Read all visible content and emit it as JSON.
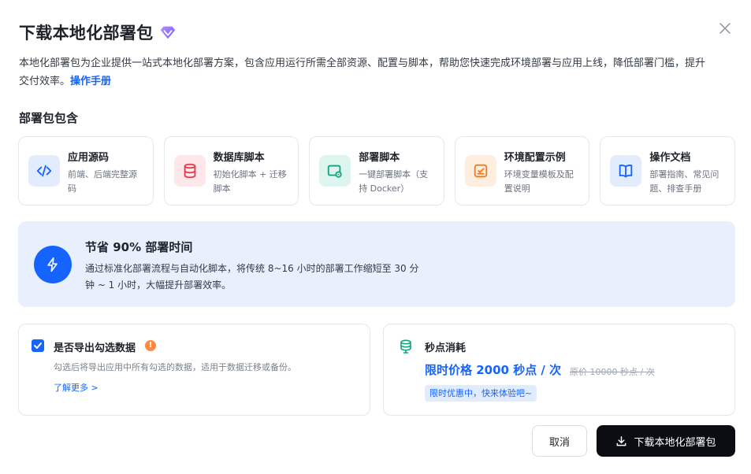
{
  "dialog": {
    "title": "下载本地化部署包",
    "description_pre": "本地化部署包为企业提供一站式本地化部署方案，包含应用运行所需全部资源、配置与脚本，帮助您快速完成环境部署与应用上线，降低部署门槛，提升交付效率。",
    "manual_link": "操作手册"
  },
  "section_title": "部署包包含",
  "cards": [
    {
      "title": "应用源码",
      "desc": "前端、后端完整源码",
      "icon": "code-icon",
      "color": "#1664ff",
      "bg": "#e3ecfd"
    },
    {
      "title": "数据库脚本",
      "desc": "初始化脚本 + 迁移脚本",
      "icon": "database-icon",
      "color": "#e5384d",
      "bg": "#fde7ea"
    },
    {
      "title": "部署脚本",
      "desc": "一键部署脚本（支持 Docker）",
      "icon": "deploy-icon",
      "color": "#14a37f",
      "bg": "#ddf5ee"
    },
    {
      "title": "环境配置示例",
      "desc": "环境变量模板及配置说明",
      "icon": "config-icon",
      "color": "#f07a22",
      "bg": "#fdeedf"
    },
    {
      "title": "操作文档",
      "desc": "部署指南、常见问题、排查手册",
      "icon": "book-icon",
      "color": "#1664ff",
      "bg": "#e3ecfd"
    }
  ],
  "banner": {
    "title": "节省 90% 部署时间",
    "desc": "通过标准化部署流程与自动化脚本，将传统 8~16 小时的部署工作缩短至 30 分钟 ~ 1 小时，大幅提升部署效率。"
  },
  "export": {
    "checked": true,
    "title": "是否导出勾选数据",
    "warn_glyph": "!",
    "desc": "勾选后将导出应用中所有勾选的数据，适用于数据迁移或备份。",
    "learn_more": "了解更多 >"
  },
  "cost": {
    "title": "秒点消耗",
    "price": "限时价格 2000 秒点 / 次",
    "original": "原价 10000 秒点 / 次",
    "promo": "限时优惠中，快来体验吧~"
  },
  "buttons": {
    "cancel": "取消",
    "download": "下载本地化部署包"
  },
  "colors": {
    "accent": "#1664ff",
    "primary_button": "#0b0d12",
    "banner_bg": "#e8f0fd"
  }
}
